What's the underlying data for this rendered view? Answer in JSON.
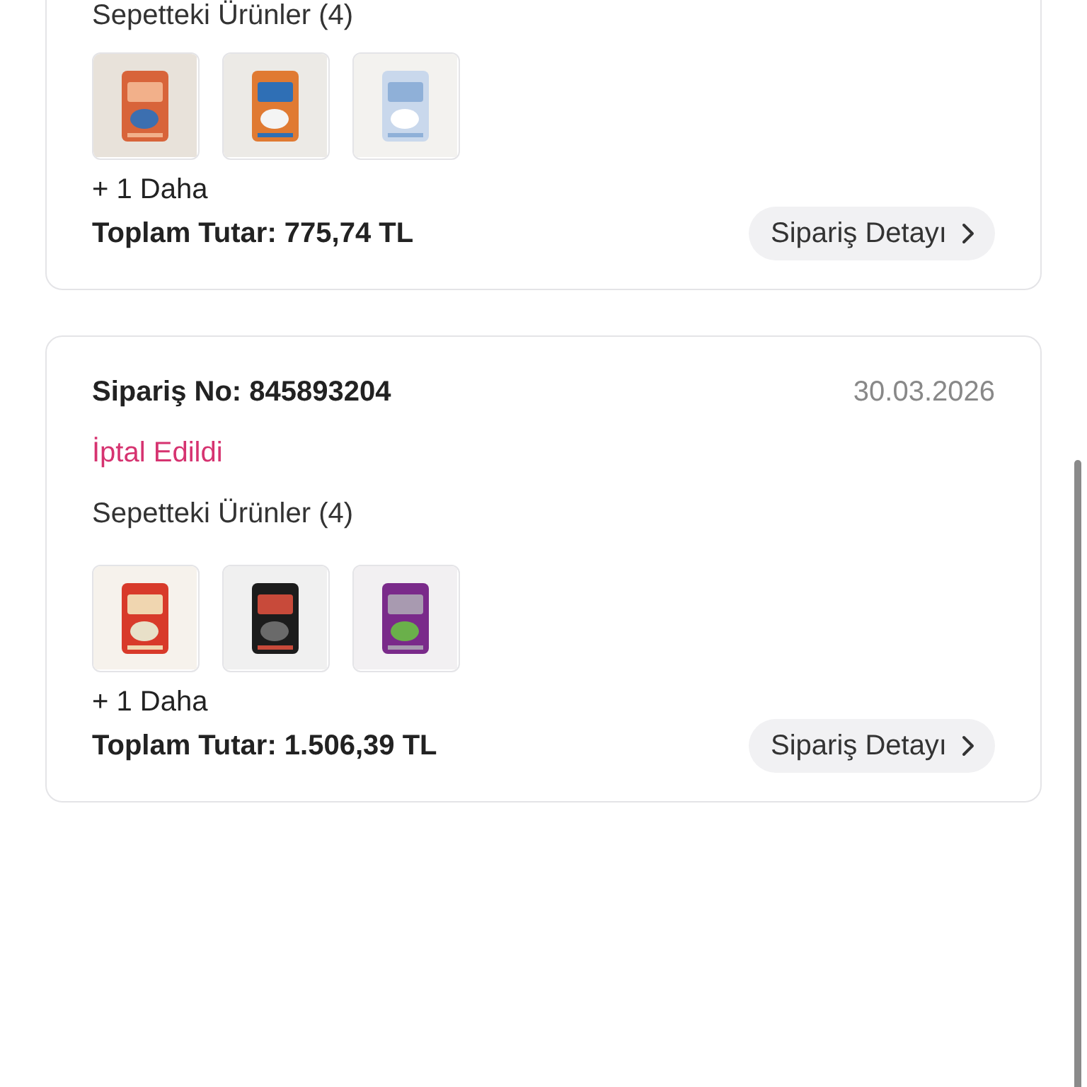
{
  "orders": [
    {
      "items_label": "Sepetteki Ürünler (4)",
      "more": "+ 1 Daha",
      "total": "Toplam Tutar: 775,74 TL",
      "detail_button": "Sipariş Detayı"
    },
    {
      "order_no": "Sipariş No: 845893204",
      "date": "30.03.2026",
      "status": "İptal Edildi",
      "items_label": "Sepetteki Ürünler (4)",
      "more": "+ 1 Daha",
      "total": "Toplam Tutar: 1.506,39 TL",
      "detail_button": "Sipariş Detayı"
    }
  ]
}
